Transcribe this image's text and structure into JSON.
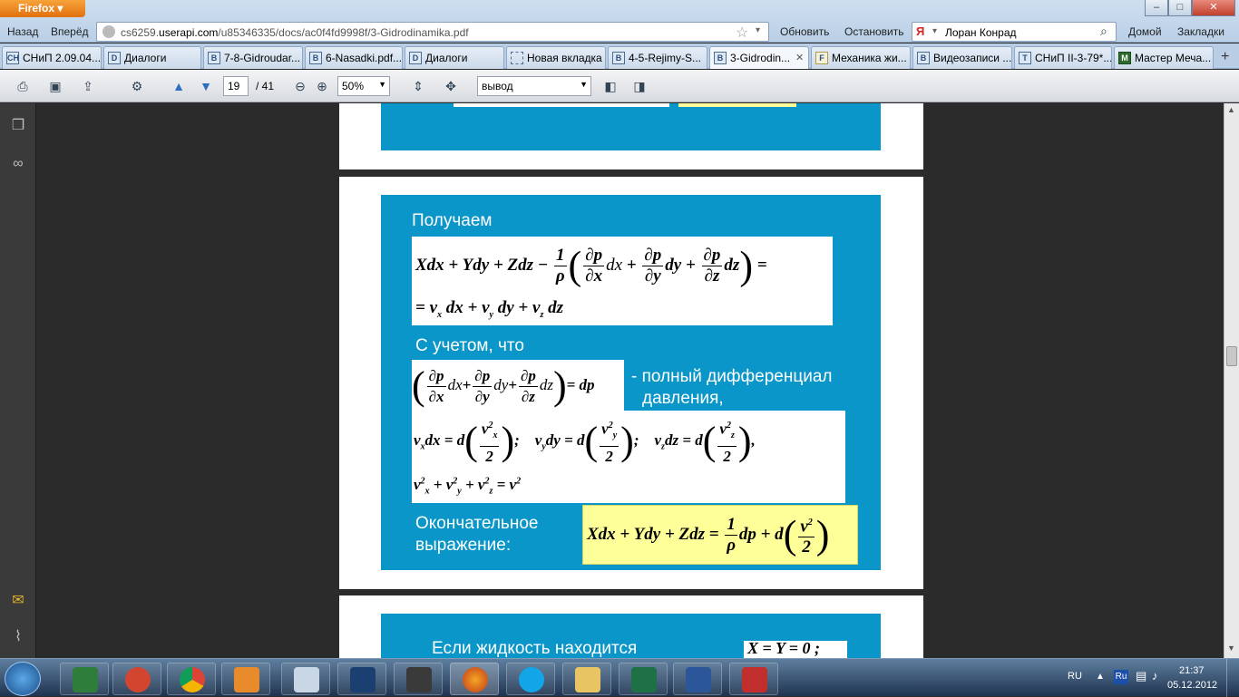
{
  "browser": {
    "menu_button": "Firefox",
    "back": "Назад",
    "forward": "Вперёд",
    "url_prefix": "cs6259.",
    "url_domain": "userapi.com",
    "url_path": "/u85346335/docs/ac0f4fd9998f/3-Gidrodinamika.pdf",
    "refresh": "Обновить",
    "stop": "Остановить",
    "search_value": "Лоран Конрад",
    "home": "Домой",
    "bookmarks": "Закладки",
    "win_min": "–",
    "win_max": "□",
    "win_close": "✕"
  },
  "tabs": [
    {
      "label": "СНиП 2.09.04...",
      "icon": "СН"
    },
    {
      "label": "Диалоги",
      "icon": "D"
    },
    {
      "label": "7-8-Gidroudar...",
      "icon": "B"
    },
    {
      "label": "6-Nasadki.pdf...",
      "icon": "B"
    },
    {
      "label": "Диалоги",
      "icon": "D"
    },
    {
      "label": "Новая вкладка",
      "icon": ""
    },
    {
      "label": "4-5-Rejimy-S...",
      "icon": "B"
    },
    {
      "label": "3-Gidrodin...",
      "icon": "B",
      "active": true
    },
    {
      "label": "Механика жи...",
      "icon": "F"
    },
    {
      "label": "Видеозаписи ...",
      "icon": "B"
    },
    {
      "label": "СНиП II-3-79*...",
      "icon": "T"
    },
    {
      "label": "Мастер Меча...",
      "icon": "M"
    }
  ],
  "tab_close": "✕",
  "new_tab": "+",
  "pdf_toolbar": {
    "page_current": "19",
    "page_total": "/ 41",
    "zoom": "50%",
    "search_mode": "вывод"
  },
  "slide": {
    "obtain_label": "Получаем",
    "formula1_line1": "Xdx + Ydy + Zdz −",
    "formula1_coef_num": "1",
    "formula1_coef_den": "ρ",
    "f1_dp": "∂p",
    "f1_dx": "∂x",
    "f1_dy": "∂y",
    "f1_dz": "∂z",
    "f1_dx_var": "dx",
    "f1_dy_var": "dy",
    "f1_dz_var": "dz",
    "f1_plus": "+",
    "f1_eq": "=",
    "formula1_line2_a": "= v",
    "formula1_line2_sx": "x",
    "formula1_line2_b": "dx + v",
    "formula1_line2_sy": "y",
    "formula1_line2_c": "dy + v",
    "formula1_line2_sz": "z",
    "formula1_line2_d": "dz",
    "given_label": "С учетом, что",
    "formula2_rhs": "= dp",
    "full_diff_label": "- полный дифференциал",
    "pressure_label": "давления,",
    "f3_v": "v",
    "f3_two": "2",
    "f3_d": "= d",
    "f3_semicolon": ";",
    "f3_comma": ",",
    "f3_sx": "x",
    "f3_sy": "y",
    "f3_sz": "z",
    "f3_dx": "dx",
    "f3_dy": "dy",
    "f3_dz": "dz",
    "f4_text": "+ v",
    "f4_eq": "= v",
    "final_label_1": "Окончательное",
    "final_label_2": "выражение:",
    "final_formula_a": "Xdx + Ydy + Zdz =",
    "final_coef_num": "1",
    "final_coef_den": "ρ",
    "final_formula_b": "dp + d",
    "final_v2": "v",
    "final_two": "2",
    "next_slide_text": "Если жидкость находится",
    "next_slide_formula": "X = Y = 0 ;"
  },
  "tray": {
    "lang": "RU",
    "lang_icon": "Ru",
    "time": "21:37",
    "date": "05.12.2012"
  },
  "colors": {
    "slide_bg": "#0a96c8",
    "final_box_bg": "#ffff99",
    "page_bg": "#ffffff",
    "viewer_bg": "#2b2b2b"
  }
}
